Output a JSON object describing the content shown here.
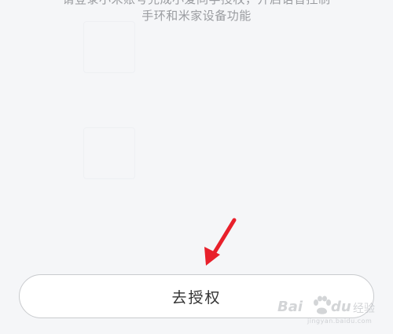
{
  "description": {
    "line1": "请登录小米账号完成小爱同学授权，开启语音控制",
    "line2": "手环和米家设备功能"
  },
  "button": {
    "label": "去授权"
  },
  "watermark": {
    "brand": "Bai",
    "brand_du": "du",
    "suffix": "经验",
    "url": "jingyan.baidu.com"
  },
  "colors": {
    "background": "#f5f6f8",
    "arrow": "#e8202b",
    "button_border": "#c9cbce",
    "text_muted": "#9a9ca0"
  }
}
